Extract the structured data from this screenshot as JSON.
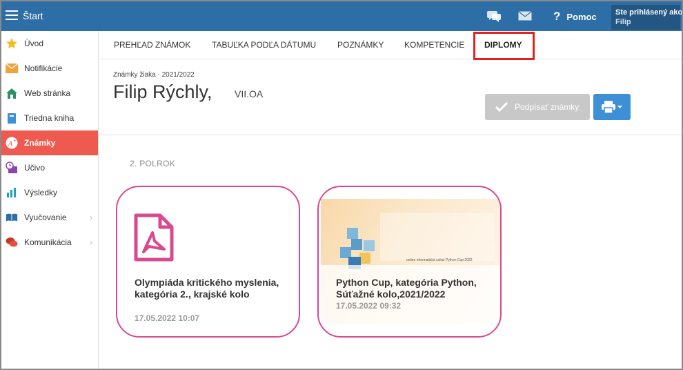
{
  "topbar": {
    "title": "Štart",
    "help_label": "Pomoc",
    "user_line1": "Ste prihlásený ako",
    "user_line2": "Filip",
    "color": "#2e6ea6"
  },
  "sidebar": {
    "items": [
      {
        "label": "Úvod",
        "icon": "star-icon"
      },
      {
        "label": "Notifikácie",
        "icon": "envelope-icon"
      },
      {
        "label": "Web stránka",
        "icon": "house-icon"
      },
      {
        "label": "Triedna kniha",
        "icon": "book-icon"
      },
      {
        "label": "Známky",
        "icon": "grade-icon",
        "active": true
      },
      {
        "label": "Učivo",
        "icon": "curriculum-icon"
      },
      {
        "label": "Výsledky",
        "icon": "bar-chart-icon"
      },
      {
        "label": "Vyučovanie",
        "icon": "open-book-icon"
      },
      {
        "label": "Komunikácia",
        "icon": "speech-bubbles-icon"
      }
    ],
    "active_color": "#ee5a4f"
  },
  "tabs": [
    {
      "label": "PREHĽAD ZNÁMOK"
    },
    {
      "label": "TABUĽKA PODĽA DÁTUMU"
    },
    {
      "label": "POZNÁMKY"
    },
    {
      "label": "KOMPETENCIE"
    },
    {
      "label": "DIPLOMY",
      "selected": true
    }
  ],
  "header": {
    "crumb": "Známky žiaka · 2021/2022",
    "student_name": "Filip Rýchly,",
    "class_name": "VII.OA",
    "sign_label": "Podpísať známky"
  },
  "section": {
    "semester": "2. POLROK"
  },
  "cards": [
    {
      "title": "Olympiáda kritického myslenia, kategória 2., krajské kolo",
      "date": "17.05.2022 10:07",
      "icon": "pdf-icon"
    },
    {
      "title": "Python Cup, kategória Python, Súťažné kolo,2021/2022",
      "date": "17.05.2022 09:32",
      "thumb_caption": "online informatická súťaž Python Cup 2022"
    }
  ],
  "colors": {
    "card_border": "#d9498f",
    "highlight": "#e0231f",
    "print_button": "#3d8fd6",
    "sign_button": "#c8c8c8"
  }
}
